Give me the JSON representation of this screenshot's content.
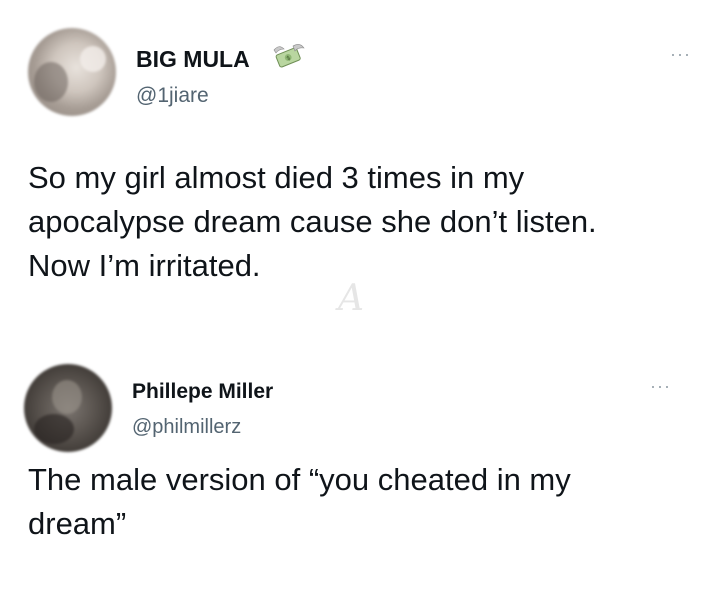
{
  "tweets": [
    {
      "display_name": "BIG MULA",
      "handle": "@1jiare",
      "name_emoji": "money-with-wings-icon",
      "more_label": "···",
      "text_lines": [
        "So my girl almost died 3 times in my",
        "apocalypse dream cause she don’t listen.",
        "Now I’m irritated."
      ]
    },
    {
      "display_name": "Phillepe Miller",
      "handle": "@philmillerz",
      "more_label": "···",
      "text_lines": [
        "The male version of “you cheated in my",
        "dream”"
      ]
    }
  ],
  "watermark": "A",
  "colors": {
    "text": "#0f1419",
    "secondary": "#536471",
    "background": "#ffffff"
  }
}
